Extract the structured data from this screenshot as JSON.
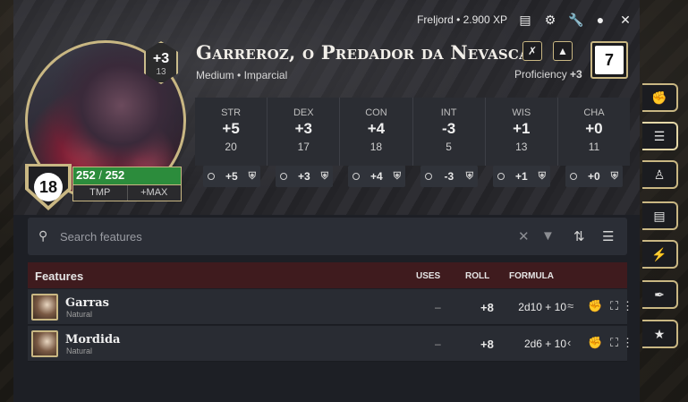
{
  "topbar": {
    "realm": "Freljord",
    "xp": "2.900 XP"
  },
  "character": {
    "name": "Garreroz, o Predador da Nevasca",
    "size": "Medium",
    "alignment": "Imparcial",
    "cr_bonus": "+3",
    "cr_sub": "13",
    "ac": "18",
    "hp_current": "252",
    "hp_max": "252",
    "tmp_label": "TMP",
    "max_label": "+MAX",
    "proficiency_label": "Proficiency",
    "proficiency": "+3",
    "prof_box": "7"
  },
  "abilities": [
    {
      "label": "STR",
      "mod": "+5",
      "score": "20",
      "save": "+5"
    },
    {
      "label": "DEX",
      "mod": "+3",
      "score": "17",
      "save": "+3"
    },
    {
      "label": "CON",
      "mod": "+4",
      "score": "18",
      "save": "+4"
    },
    {
      "label": "INT",
      "mod": "-3",
      "score": "5",
      "save": "-3"
    },
    {
      "label": "WIS",
      "mod": "+1",
      "score": "13",
      "save": "+1"
    },
    {
      "label": "CHA",
      "mod": "+0",
      "score": "11",
      "save": "+0"
    }
  ],
  "search": {
    "placeholder": "Search features"
  },
  "features_header": {
    "title": "Features",
    "uses": "USES",
    "roll": "ROLL",
    "formula": "FORMULA"
  },
  "features": [
    {
      "name": "Garras",
      "type": "Natural",
      "uses": "–",
      "roll": "+8",
      "formula": "2d10 + 10"
    },
    {
      "name": "Mordida",
      "type": "Natural",
      "uses": "–",
      "roll": "+8",
      "formula": "2d6 + 10"
    }
  ],
  "colors": {
    "accent_gold": "#c9b783",
    "hp_green": "#2c8c3c",
    "features_header": "#3f1b1e"
  },
  "icons": [
    "wrench-icon",
    "journal-icon",
    "gear-icon",
    "user-icon",
    "close-icon",
    "search-icon",
    "filter-icon",
    "sort-icon",
    "layers-icon",
    "fist-icon",
    "list-icon",
    "person-icon",
    "book-icon",
    "bolt-icon",
    "feather-icon",
    "star-icon"
  ]
}
